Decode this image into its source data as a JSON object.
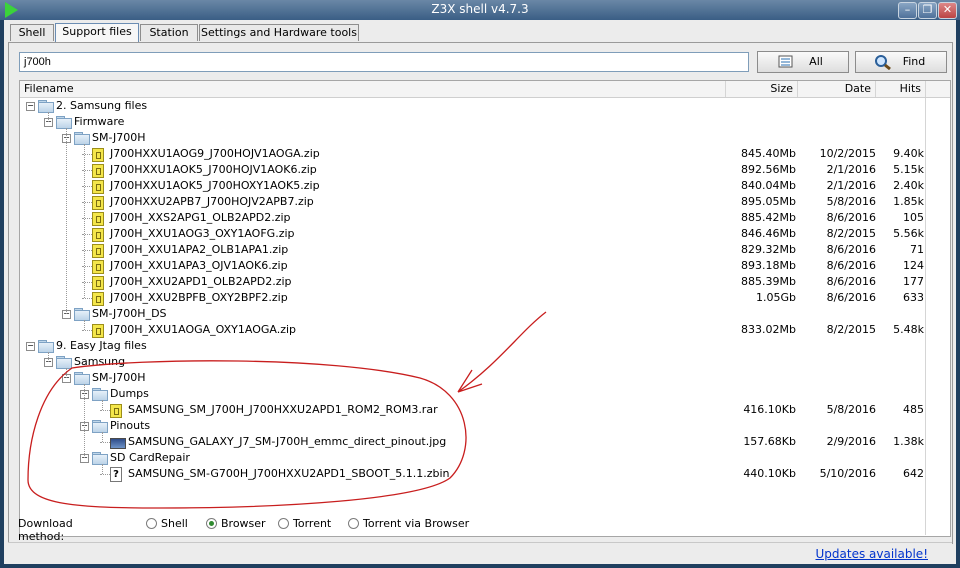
{
  "window": {
    "title": "Z3X shell v4.7.3",
    "minimize_glyph": "–",
    "restore_glyph": "❐",
    "close_glyph": "✕"
  },
  "tabs": [
    {
      "label": "Shell"
    },
    {
      "label": "Support files",
      "active": true
    },
    {
      "label": "Station"
    },
    {
      "label": "Settings and Hardware tools"
    }
  ],
  "search": {
    "value": "j700h"
  },
  "buttons": {
    "all_label": "All",
    "find_label": "Find"
  },
  "columns": {
    "filename": "Filename",
    "size": "Size",
    "date": "Date",
    "hits": "Hits"
  },
  "tree": [
    {
      "kind": "folder",
      "name": "2. Samsung files",
      "level": 0
    },
    {
      "kind": "folder",
      "name": "Firmware",
      "level": 1
    },
    {
      "kind": "folder",
      "name": "SM-J700H",
      "level": 2
    },
    {
      "kind": "zip",
      "name": "J700HXXU1AOG9_J700HOJV1AOGA.zip",
      "level": 3,
      "size": "845.40Mb",
      "date": "10/2/2015",
      "hits": "9.40k"
    },
    {
      "kind": "zip",
      "name": "J700HXXU1AOK5_J700HOJV1AOK6.zip",
      "level": 3,
      "size": "892.56Mb",
      "date": "2/1/2016",
      "hits": "5.15k"
    },
    {
      "kind": "zip",
      "name": "J700HXXU1AOK5_J700HOXY1AOK5.zip",
      "level": 3,
      "size": "840.04Mb",
      "date": "2/1/2016",
      "hits": "2.40k"
    },
    {
      "kind": "zip",
      "name": "J700HXXU2APB7_J700HOJV2APB7.zip",
      "level": 3,
      "size": "895.05Mb",
      "date": "5/8/2016",
      "hits": "1.85k"
    },
    {
      "kind": "zip",
      "name": "J700H_XXS2APG1_OLB2APD2.zip",
      "level": 3,
      "size": "885.42Mb",
      "date": "8/6/2016",
      "hits": "105"
    },
    {
      "kind": "zip",
      "name": "J700H_XXU1AOG3_OXY1AOFG.zip",
      "level": 3,
      "size": "846.46Mb",
      "date": "8/2/2015",
      "hits": "5.56k"
    },
    {
      "kind": "zip",
      "name": "J700H_XXU1APA2_OLB1APA1.zip",
      "level": 3,
      "size": "829.32Mb",
      "date": "8/6/2016",
      "hits": "71"
    },
    {
      "kind": "zip",
      "name": "J700H_XXU1APA3_OJV1AOK6.zip",
      "level": 3,
      "size": "893.18Mb",
      "date": "8/6/2016",
      "hits": "124"
    },
    {
      "kind": "zip",
      "name": "J700H_XXU2APD1_OLB2APD2.zip",
      "level": 3,
      "size": "885.39Mb",
      "date": "8/6/2016",
      "hits": "177"
    },
    {
      "kind": "zip",
      "name": "J700H_XXU2BPFB_OXY2BPF2.zip",
      "level": 3,
      "size": "1.05Gb",
      "date": "8/6/2016",
      "hits": "633"
    },
    {
      "kind": "folder",
      "name": "SM-J700H_DS",
      "level": 2
    },
    {
      "kind": "zip",
      "name": "J700H_XXU1AOGA_OXY1AOGA.zip",
      "level": 3,
      "size": "833.02Mb",
      "date": "8/2/2015",
      "hits": "5.48k"
    },
    {
      "kind": "folder",
      "name": "9. Easy Jtag files",
      "level": 0
    },
    {
      "kind": "folder",
      "name": "Samsung",
      "level": 1
    },
    {
      "kind": "folder",
      "name": "SM-J700H",
      "level": 2
    },
    {
      "kind": "folder",
      "name": "Dumps",
      "level": 3
    },
    {
      "kind": "zip",
      "name": "SAMSUNG_SM_J700H_J700HXXU2APD1_ROM2_ROM3.rar",
      "level": 4,
      "size": "416.10Kb",
      "date": "5/8/2016",
      "hits": "485"
    },
    {
      "kind": "folder",
      "name": "Pinouts",
      "level": 3
    },
    {
      "kind": "jpg",
      "name": "SAMSUNG_GALAXY_J7_SM-J700H_emmc_direct_pinout.jpg",
      "level": 4,
      "size": "157.68Kb",
      "date": "2/9/2016",
      "hits": "1.38k"
    },
    {
      "kind": "folder",
      "name": "SD CardRepair",
      "level": 3
    },
    {
      "kind": "unknown",
      "name": "SAMSUNG_SM-G700H_J700HXXU2APD1_SBOOT_5.1.1.zbin",
      "level": 4,
      "size": "440.10Kb",
      "date": "5/10/2016",
      "hits": "642"
    }
  ],
  "download": {
    "label": "Download method:",
    "options": [
      {
        "label": "Shell",
        "selected": false
      },
      {
        "label": "Browser",
        "selected": true
      },
      {
        "label": "Torrent",
        "selected": false
      },
      {
        "label": "Torrent via Browser",
        "selected": false
      }
    ]
  },
  "status": {
    "updates_link": "Updates available!"
  },
  "colors": {
    "annotation_red": "#c81e1e",
    "folder_blue": "#bcd3e8",
    "zip_yellow": "#f4e64a",
    "title_bar": "#3a5e85"
  }
}
